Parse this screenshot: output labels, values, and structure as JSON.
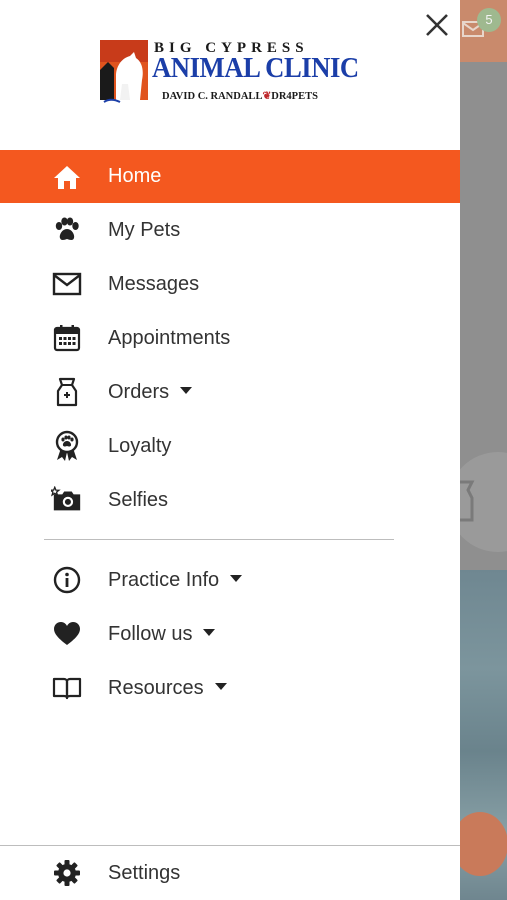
{
  "background": {
    "notification_count": "5"
  },
  "drawer": {
    "logo": {
      "line1": "BIG CYPRESS",
      "line2": "ANIMAL CLINIC",
      "line3_left": "DAVID C. RANDALL",
      "line3_right": "DR4PETS"
    },
    "primary_items": [
      {
        "label": "Home",
        "icon": "home-icon",
        "active": true,
        "expandable": false
      },
      {
        "label": "My Pets",
        "icon": "paw-icon",
        "active": false,
        "expandable": false
      },
      {
        "label": "Messages",
        "icon": "mail-icon",
        "active": false,
        "expandable": false
      },
      {
        "label": "Appointments",
        "icon": "calendar-icon",
        "active": false,
        "expandable": false
      },
      {
        "label": "Orders",
        "icon": "pet-food-bag-icon",
        "active": false,
        "expandable": true
      },
      {
        "label": "Loyalty",
        "icon": "ribbon-badge-icon",
        "active": false,
        "expandable": false
      },
      {
        "label": "Selfies",
        "icon": "camera-icon",
        "active": false,
        "expandable": false
      }
    ],
    "secondary_items": [
      {
        "label": "Practice Info",
        "icon": "info-icon",
        "expandable": true
      },
      {
        "label": "Follow us",
        "icon": "heart-icon",
        "expandable": true
      },
      {
        "label": "Resources",
        "icon": "book-icon",
        "expandable": true
      }
    ],
    "settings": {
      "label": "Settings",
      "icon": "gear-icon"
    }
  },
  "colors": {
    "accent": "#f4581f",
    "text": "#333333",
    "logo_blue": "#1b3ea8"
  }
}
